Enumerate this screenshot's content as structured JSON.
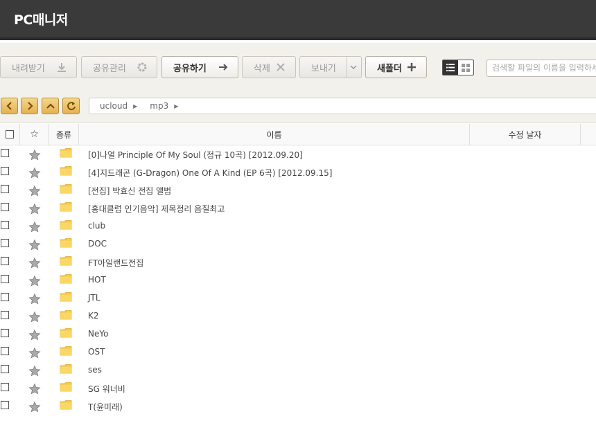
{
  "app": {
    "title": "PC매니저"
  },
  "toolbar": {
    "download_label": "내려받기",
    "share_manage_label": "공유관리",
    "share_label": "공유하기",
    "delete_label": "삭제",
    "send_label": "보내기",
    "new_folder_label": "새폴더"
  },
  "search": {
    "placeholder": "검색할 파일의 이름을 입력하세요"
  },
  "breadcrumb": [
    "ucloud",
    "mp3"
  ],
  "table": {
    "headers": {
      "star": "☆",
      "type": "종류",
      "name": "이름",
      "modified": "수정 날자"
    },
    "rows": [
      "[0]나얼 Principle Of My Soul (정규 10곡) [2012.09.20]",
      "[4]지드래곤 (G-Dragon)   One Of A Kind (EP 6곡) [2012.09.15]",
      "[전집] 박효신 전집 앨범",
      "[홍대클럽 인기음악] 제목정리 음질최고",
      "club",
      "DOC",
      "FT아일랜드전집",
      "HOT",
      "JTL",
      "K2",
      "NeYo",
      "OST",
      "ses",
      "SG 워너비",
      "T(윤미래)"
    ]
  },
  "colors": {
    "titlebar": "#3a3a3a",
    "folder": "#f7c948",
    "nav_button": "#e4b24f"
  }
}
